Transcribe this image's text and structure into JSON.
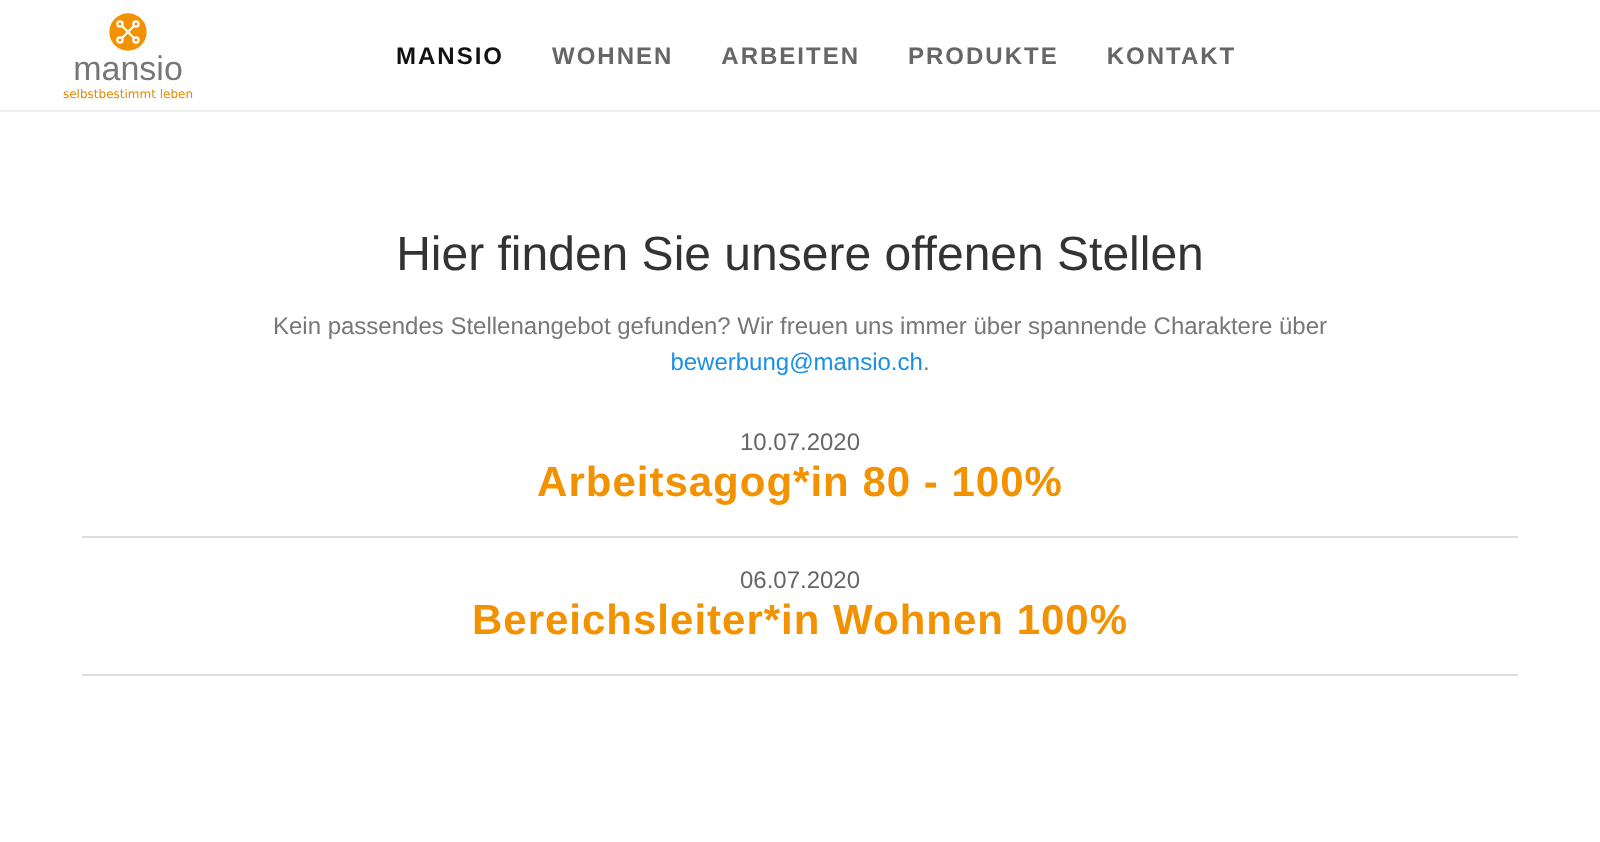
{
  "logo": {
    "name": "mansio",
    "tagline": "selbstbestimmt leben"
  },
  "nav": [
    {
      "label": "MANSIO",
      "selected": true
    },
    {
      "label": "WOHNEN",
      "selected": false
    },
    {
      "label": "ARBEITEN",
      "selected": false
    },
    {
      "label": "PRODUKTE",
      "selected": false
    },
    {
      "label": "KONTAKT",
      "selected": false
    }
  ],
  "heading": "Hier finden Sie unsere offenen Stellen",
  "intro": {
    "text": "Kein passendes Stellenangebot gefunden? Wir freuen uns immer über spannende Charaktere über",
    "link": "bewerbung@mansio.ch",
    "end": "."
  },
  "jobs": [
    {
      "date": "10.07.2020",
      "title": "Arbeitsagog*in 80 - 100%"
    },
    {
      "date": "06.07.2020",
      "title": "Bereichsleiter*in Wohnen 100%"
    }
  ]
}
